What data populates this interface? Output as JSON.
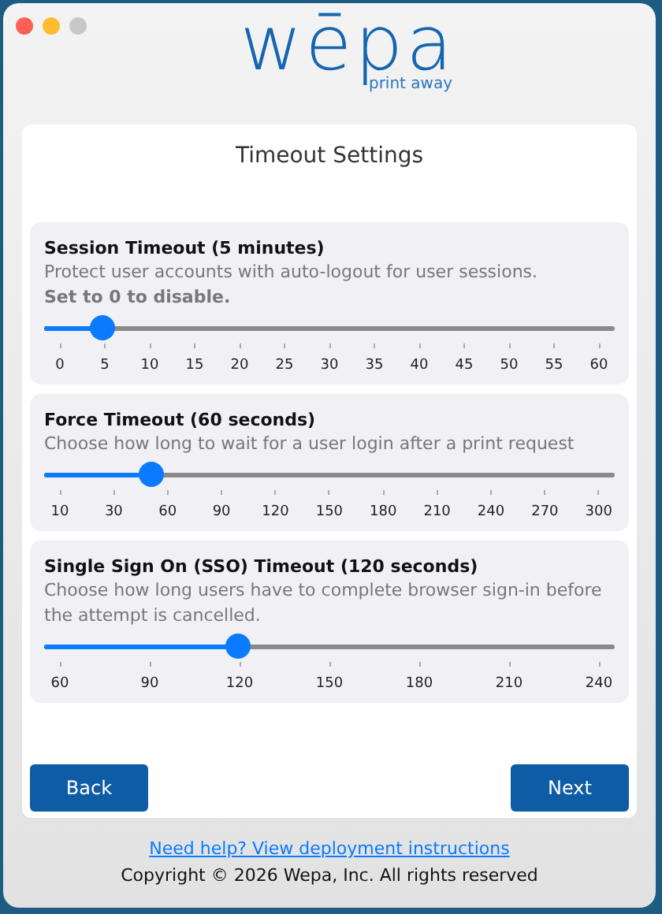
{
  "logo": {
    "wordmark": "wēpa",
    "tagline": "print away"
  },
  "title": "Timeout Settings",
  "sections": [
    {
      "heading": "Session Timeout (5 minutes)",
      "description": "Protect user accounts with auto-logout for user sessions.",
      "note": "Set to 0 to disable.",
      "level": 0.0833,
      "ticks": [
        "0",
        "5",
        "10",
        "15",
        "20",
        "25",
        "30",
        "35",
        "40",
        "45",
        "50",
        "55",
        "60"
      ]
    },
    {
      "heading": "Force Timeout (60 seconds)",
      "description": "Choose how long to wait for a user login after a print request",
      "level": 0.172,
      "ticks": [
        "10",
        "30",
        "60",
        "90",
        "120",
        "150",
        "180",
        "210",
        "240",
        "270",
        "300"
      ]
    },
    {
      "heading": "Single Sign On (SSO) Timeout (120 seconds)",
      "description": "Choose how long users have to complete browser sign-in before the attempt is cancelled.",
      "level": 0.333,
      "ticks": [
        "60",
        "90",
        "120",
        "150",
        "180",
        "210",
        "240"
      ]
    }
  ],
  "buttons": {
    "back": "Back",
    "next": "Next"
  },
  "help_link": "Need help? View deployment instructions",
  "copyright": "Copyright © 2026 Wepa, Inc. All rights reserved"
}
